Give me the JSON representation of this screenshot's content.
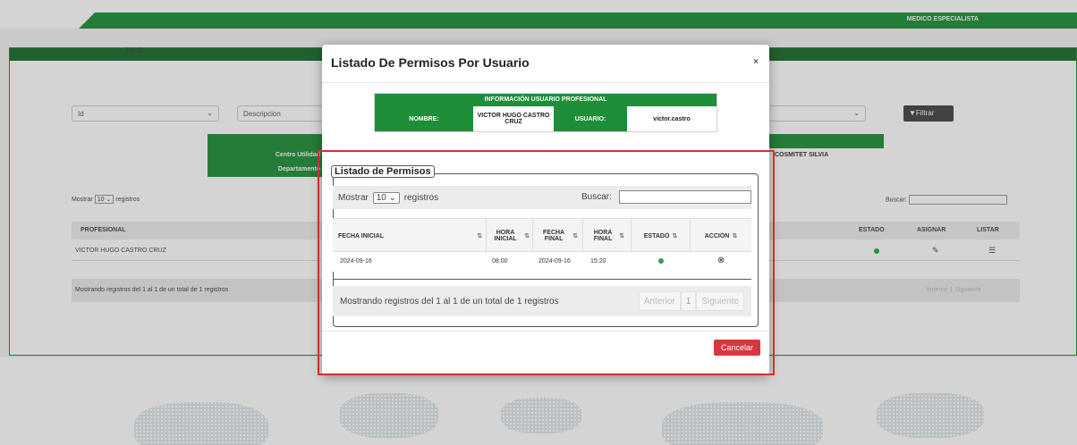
{
  "header": {
    "role": "MEDICO ESPECIALISTA"
  },
  "filters": {
    "tipo_label": "TIPO:",
    "tipo_value": "Id",
    "descripcion_placeholder": "Descripcion",
    "filter_button": "Filtrar"
  },
  "background": {
    "info_labels": [
      "Centro Utilidad",
      "Departamento"
    ],
    "info_value": "COSMITET SILVIA",
    "show_prefix": "Mostrar",
    "show_value": "10",
    "show_suffix": "registros",
    "search_label": "Buscar:",
    "columns": [
      "PROFESIONAL",
      "ESTADO",
      "ASIGNAR",
      "LISTAR"
    ],
    "rows": [
      {
        "profesional": "VICTOR HUGO CASTRO CRUZ"
      }
    ],
    "footer_info": "Mostrando registros del 1 al 1 de un total de 1 registros",
    "pager": {
      "prev": "Anterior",
      "page": "1",
      "next": "Siguiente"
    }
  },
  "modal": {
    "title": "Listado De Permisos Por Usuario",
    "close": "×",
    "info_table": {
      "heading": "INFORMACIÓN USUARIO PROFESIONAL",
      "nombre_label": "NOMBRE:",
      "nombre_value": "VICTOR HUGO CASTRO CRUZ",
      "usuario_label": "USUARIO:",
      "usuario_value": "victor.castro"
    },
    "section_title": "Listado de Permisos",
    "show_prefix": "Mostrar",
    "show_value": "10",
    "show_suffix": "registros",
    "search_label": "Buscar:",
    "columns": [
      {
        "label": "FECHA INICIAL"
      },
      {
        "label": "HORA INICIAL"
      },
      {
        "label": "FECHA FINAL"
      },
      {
        "label": "HORA FINAL"
      },
      {
        "label": "ESTADO"
      },
      {
        "label": "ACCION"
      }
    ],
    "rows": [
      {
        "fecha_inicial": "2024-09-16",
        "hora_inicial": "08:00",
        "fecha_final": "2024-09-16",
        "hora_final": "15:20",
        "estado_color": "#27a844",
        "accion_icon": "⊗"
      }
    ],
    "footer_info": "Mostrando registros del 1 al 1 de un total de 1 registros",
    "pager": {
      "prev": "Anterior",
      "page": "1",
      "next": "Siguiente"
    },
    "cancel_button": "Cancelar"
  },
  "colors": {
    "primary_green": "#1e8f38",
    "danger": "#d9373f",
    "highlight": "#d32f2f"
  }
}
